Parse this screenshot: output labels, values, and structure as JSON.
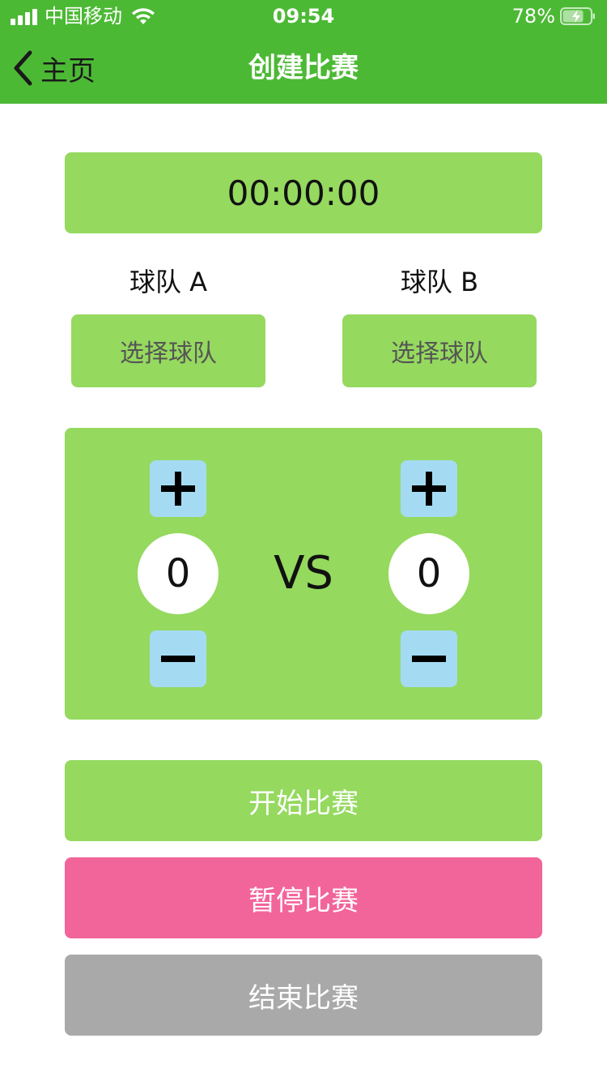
{
  "status_bar": {
    "carrier": "中国移动",
    "time": "09:54",
    "battery_percent": "78%"
  },
  "nav": {
    "back_label": "主页",
    "title": "创建比赛"
  },
  "timer": {
    "value": "00:00:00"
  },
  "teams": {
    "a": {
      "label": "球队 A",
      "select_label": "选择球队"
    },
    "b": {
      "label": "球队 B",
      "select_label": "选择球队"
    }
  },
  "score": {
    "a": "0",
    "b": "0",
    "vs_label": "VS"
  },
  "actions": {
    "start": "开始比赛",
    "pause": "暂停比赛",
    "end": "结束比赛"
  },
  "colors": {
    "nav_green": "#4cb935",
    "panel_green": "#95d95f",
    "stepper_blue": "#a4dbf3",
    "pause_pink": "#f2659a",
    "end_gray": "#a9a9a9"
  },
  "icons": {
    "back": "chevron-left-icon",
    "plus": "plus-icon",
    "minus": "minus-icon",
    "wifi": "wifi-icon",
    "battery": "battery-charging-icon",
    "signal": "signal-icon"
  }
}
